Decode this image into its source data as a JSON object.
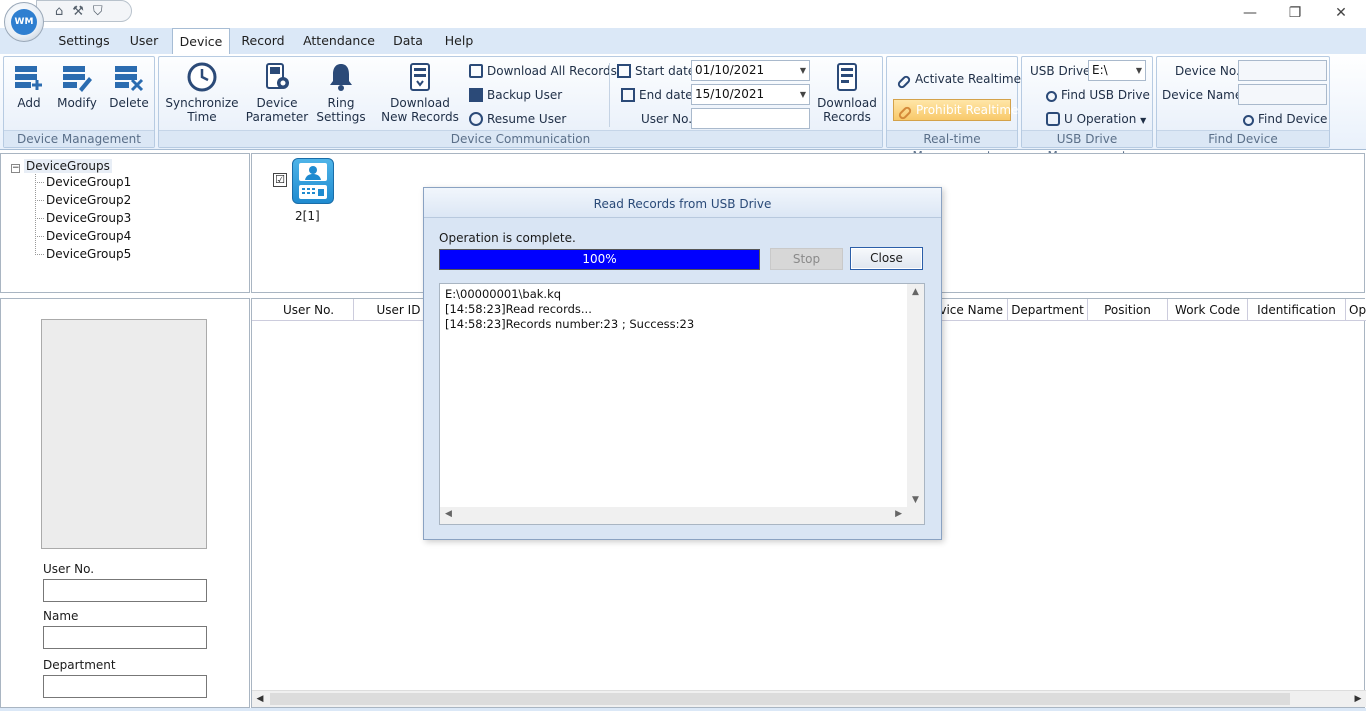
{
  "quick_access": {
    "icons": [
      "home-icon",
      "tools-icon",
      "dropdown-icon"
    ]
  },
  "window_controls": {
    "minimize": "—",
    "restore": "❐",
    "close": "✕"
  },
  "tabs": [
    {
      "label": "Settings"
    },
    {
      "label": "User"
    },
    {
      "label": "Device"
    },
    {
      "label": "Record"
    },
    {
      "label": "Attendance"
    },
    {
      "label": "Data"
    },
    {
      "label": "Help"
    }
  ],
  "ribbon": {
    "device_management": {
      "label": "Device Management",
      "add": "Add",
      "modify": "Modify",
      "delete": "Delete"
    },
    "device_communication": {
      "label": "Device Communication",
      "sync_line1": "Synchronize",
      "sync_line2": "Time",
      "param_line1": "Device",
      "param_line2": "Parameter",
      "ring_line1": "Ring",
      "ring_line2": "Settings",
      "dlnew_line1": "Download",
      "dlnew_line2": "New Records",
      "download_all": "Download All Records",
      "backup_user": "Backup User",
      "resume_user": "Resume User",
      "start_date_label": "Start date",
      "start_date_value": "01/10/2021",
      "end_date_label": "End date",
      "end_date_value": "15/10/2021",
      "user_no_label": "User No.",
      "user_no_value": "",
      "dlrec_line1": "Download",
      "dlrec_line2": "Records"
    },
    "realtime": {
      "label": "Real-time Management",
      "activate": "Activate Realtime",
      "prohibit": "Prohibit Realtime"
    },
    "usb": {
      "label": "USB Drive Management",
      "drive_label": "USB Drive",
      "drive_value": "E:\\",
      "find": "Find USB Drive",
      "operation": "U Operation"
    },
    "find_device": {
      "label": "Find Device",
      "device_no_label": "Device No.",
      "device_no_value": "",
      "device_name_label": "Device Name",
      "device_name_value": "",
      "find": "Find Device"
    }
  },
  "tree": {
    "root": "DeviceGroups",
    "items": [
      "DeviceGroup1",
      "DeviceGroup2",
      "DeviceGroup3",
      "DeviceGroup4",
      "DeviceGroup5"
    ]
  },
  "device": {
    "label": "2[1]",
    "checked": "☑"
  },
  "info": {
    "user_no_label": "User No.",
    "name_label": "Name",
    "department_label": "Department"
  },
  "table": {
    "columns": [
      "User No.",
      "User ID",
      "Device Name",
      "Department",
      "Position",
      "Work Code",
      "Identification",
      "Op"
    ]
  },
  "modal": {
    "title": "Read Records from USB Drive",
    "message": "Operation is complete.",
    "progress_text": "100%",
    "progress": 1.0,
    "stop": "Stop",
    "close": "Close",
    "log": [
      "E:\\00000001\\bak.kq",
      "[14:58:23]Read records...",
      "[14:58:23]Records number:23 ; Success:23"
    ]
  }
}
